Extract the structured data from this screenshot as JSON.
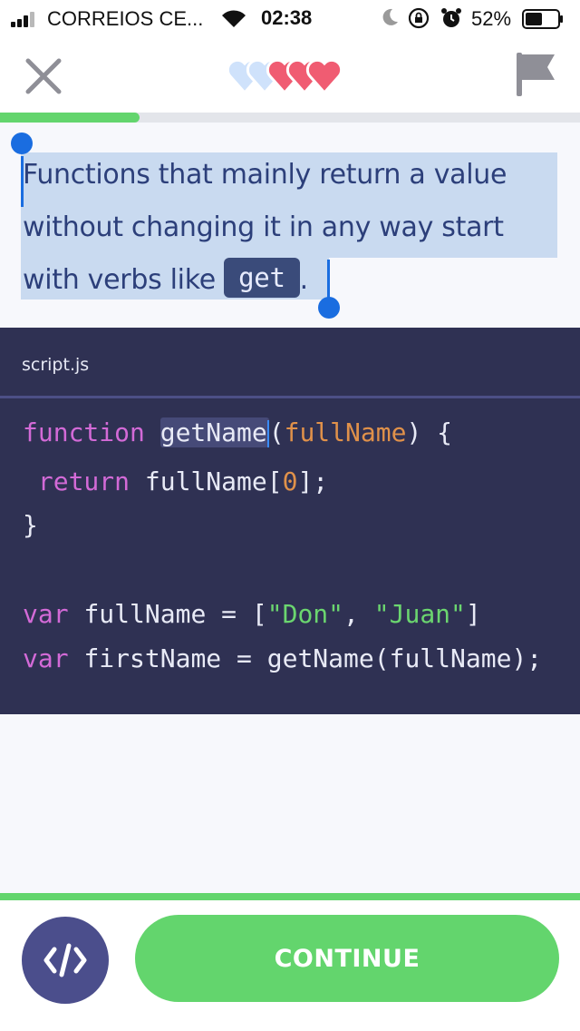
{
  "status_bar": {
    "carrier": "CORREIOS CE...",
    "time": "02:38",
    "battery_percent": "52%",
    "battery_level": 0.52,
    "signal_bars": 3,
    "icons": [
      "signal-icon",
      "wifi-icon",
      "moon-icon",
      "rotation-lock-icon",
      "alarm-icon",
      "battery-icon"
    ]
  },
  "header": {
    "close_icon": "close-icon",
    "hearts_total": 5,
    "hearts_filled": 3,
    "heart_color_filled": "#f05c72",
    "heart_color_empty": "#cfe2fb",
    "flag_icon": "flag-icon"
  },
  "progress": {
    "fraction": 0.24,
    "color": "#63d56d"
  },
  "lesson": {
    "text_line1": "Functions that mainly return a value",
    "text_line2": "without changing it in any way start",
    "text_line3_prefix": "with verbs like",
    "code_chip": "get",
    "text_line3_suffix": "."
  },
  "editor": {
    "file_name": "script.js",
    "lines": {
      "l1_kw": "function",
      "l1_name": "getName",
      "l1_open": "(",
      "l1_param": "fullName",
      "l1_close": ") {",
      "l2_kw": "return",
      "l2_expr": "fullName[",
      "l2_num": "0",
      "l2_end": "];",
      "l3": "}",
      "l4_kw": "var",
      "l4_mid": "fullName = [",
      "l4_str1": "\"Don\"",
      "l4_comma": ", ",
      "l4_str2": "\"Juan\"",
      "l4_end": "]",
      "l5_kw": "var",
      "l5_rest": "firstName = getName(fullName);"
    }
  },
  "footer": {
    "code_button_icon": "code-icon",
    "continue_label": "CONTINUE"
  }
}
